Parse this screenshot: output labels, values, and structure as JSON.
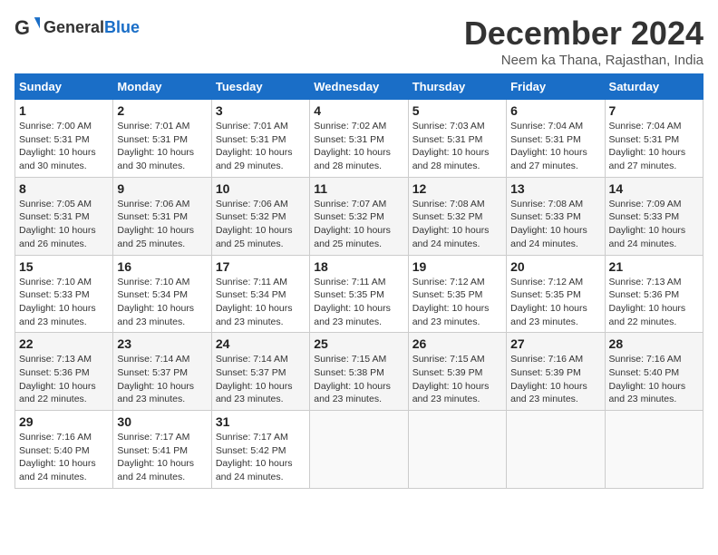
{
  "logo": {
    "text_general": "General",
    "text_blue": "Blue"
  },
  "calendar": {
    "title": "December 2024",
    "subtitle": "Neem ka Thana, Rajasthan, India"
  },
  "days_of_week": [
    "Sunday",
    "Monday",
    "Tuesday",
    "Wednesday",
    "Thursday",
    "Friday",
    "Saturday"
  ],
  "weeks": [
    [
      {
        "day": "1",
        "sunrise": "7:00 AM",
        "sunset": "5:31 PM",
        "daylight": "10 hours and 30 minutes."
      },
      {
        "day": "2",
        "sunrise": "7:01 AM",
        "sunset": "5:31 PM",
        "daylight": "10 hours and 30 minutes."
      },
      {
        "day": "3",
        "sunrise": "7:01 AM",
        "sunset": "5:31 PM",
        "daylight": "10 hours and 29 minutes."
      },
      {
        "day": "4",
        "sunrise": "7:02 AM",
        "sunset": "5:31 PM",
        "daylight": "10 hours and 28 minutes."
      },
      {
        "day": "5",
        "sunrise": "7:03 AM",
        "sunset": "5:31 PM",
        "daylight": "10 hours and 28 minutes."
      },
      {
        "day": "6",
        "sunrise": "7:04 AM",
        "sunset": "5:31 PM",
        "daylight": "10 hours and 27 minutes."
      },
      {
        "day": "7",
        "sunrise": "7:04 AM",
        "sunset": "5:31 PM",
        "daylight": "10 hours and 27 minutes."
      }
    ],
    [
      {
        "day": "8",
        "sunrise": "7:05 AM",
        "sunset": "5:31 PM",
        "daylight": "10 hours and 26 minutes."
      },
      {
        "day": "9",
        "sunrise": "7:06 AM",
        "sunset": "5:31 PM",
        "daylight": "10 hours and 25 minutes."
      },
      {
        "day": "10",
        "sunrise": "7:06 AM",
        "sunset": "5:32 PM",
        "daylight": "10 hours and 25 minutes."
      },
      {
        "day": "11",
        "sunrise": "7:07 AM",
        "sunset": "5:32 PM",
        "daylight": "10 hours and 25 minutes."
      },
      {
        "day": "12",
        "sunrise": "7:08 AM",
        "sunset": "5:32 PM",
        "daylight": "10 hours and 24 minutes."
      },
      {
        "day": "13",
        "sunrise": "7:08 AM",
        "sunset": "5:33 PM",
        "daylight": "10 hours and 24 minutes."
      },
      {
        "day": "14",
        "sunrise": "7:09 AM",
        "sunset": "5:33 PM",
        "daylight": "10 hours and 24 minutes."
      }
    ],
    [
      {
        "day": "15",
        "sunrise": "7:10 AM",
        "sunset": "5:33 PM",
        "daylight": "10 hours and 23 minutes."
      },
      {
        "day": "16",
        "sunrise": "7:10 AM",
        "sunset": "5:34 PM",
        "daylight": "10 hours and 23 minutes."
      },
      {
        "day": "17",
        "sunrise": "7:11 AM",
        "sunset": "5:34 PM",
        "daylight": "10 hours and 23 minutes."
      },
      {
        "day": "18",
        "sunrise": "7:11 AM",
        "sunset": "5:35 PM",
        "daylight": "10 hours and 23 minutes."
      },
      {
        "day": "19",
        "sunrise": "7:12 AM",
        "sunset": "5:35 PM",
        "daylight": "10 hours and 23 minutes."
      },
      {
        "day": "20",
        "sunrise": "7:12 AM",
        "sunset": "5:35 PM",
        "daylight": "10 hours and 23 minutes."
      },
      {
        "day": "21",
        "sunrise": "7:13 AM",
        "sunset": "5:36 PM",
        "daylight": "10 hours and 22 minutes."
      }
    ],
    [
      {
        "day": "22",
        "sunrise": "7:13 AM",
        "sunset": "5:36 PM",
        "daylight": "10 hours and 22 minutes."
      },
      {
        "day": "23",
        "sunrise": "7:14 AM",
        "sunset": "5:37 PM",
        "daylight": "10 hours and 23 minutes."
      },
      {
        "day": "24",
        "sunrise": "7:14 AM",
        "sunset": "5:37 PM",
        "daylight": "10 hours and 23 minutes."
      },
      {
        "day": "25",
        "sunrise": "7:15 AM",
        "sunset": "5:38 PM",
        "daylight": "10 hours and 23 minutes."
      },
      {
        "day": "26",
        "sunrise": "7:15 AM",
        "sunset": "5:39 PM",
        "daylight": "10 hours and 23 minutes."
      },
      {
        "day": "27",
        "sunrise": "7:16 AM",
        "sunset": "5:39 PM",
        "daylight": "10 hours and 23 minutes."
      },
      {
        "day": "28",
        "sunrise": "7:16 AM",
        "sunset": "5:40 PM",
        "daylight": "10 hours and 23 minutes."
      }
    ],
    [
      {
        "day": "29",
        "sunrise": "7:16 AM",
        "sunset": "5:40 PM",
        "daylight": "10 hours and 24 minutes."
      },
      {
        "day": "30",
        "sunrise": "7:17 AM",
        "sunset": "5:41 PM",
        "daylight": "10 hours and 24 minutes."
      },
      {
        "day": "31",
        "sunrise": "7:17 AM",
        "sunset": "5:42 PM",
        "daylight": "10 hours and 24 minutes."
      },
      null,
      null,
      null,
      null
    ]
  ],
  "labels": {
    "sunrise": "Sunrise:",
    "sunset": "Sunset:",
    "daylight": "Daylight:"
  }
}
